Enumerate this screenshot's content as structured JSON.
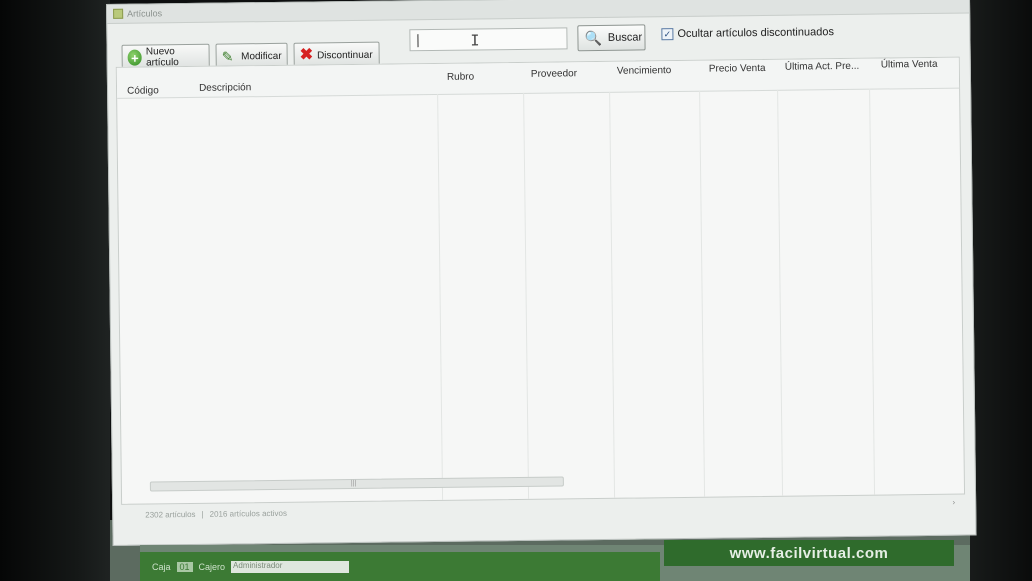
{
  "window": {
    "title": "Artículos"
  },
  "toolbar": {
    "new_label": "Nuevo artículo",
    "edit_label": "Modificar",
    "discontinue_label": "Discontinuar",
    "search_placeholder": "",
    "search_button_label": "Buscar",
    "hide_discontinued_label": "Ocultar artículos discontinuados",
    "hide_discontinued_checked": true
  },
  "grid": {
    "columns": [
      "Código",
      "Descripción",
      "Rubro",
      "Proveedor",
      "Vencimiento",
      "Precio Venta",
      "Última Act. Pre...",
      "Última Venta"
    ],
    "rows": []
  },
  "status": {
    "articles": "2302 artículos",
    "separator": "|",
    "active": "2016 artículos activos"
  },
  "footer": {
    "url": "www.facilvirtual.com",
    "caja_label": "Caja",
    "caja_value": "01",
    "cajero_label": "Cajero",
    "cajero_value": "Administrador"
  },
  "icons": {
    "new": "plus-circle-icon",
    "edit": "pencil-icon",
    "discontinue": "x-icon",
    "search": "magnifier-icon"
  },
  "colors": {
    "brand_green": "#3c7a34",
    "danger_red": "#d62020"
  }
}
